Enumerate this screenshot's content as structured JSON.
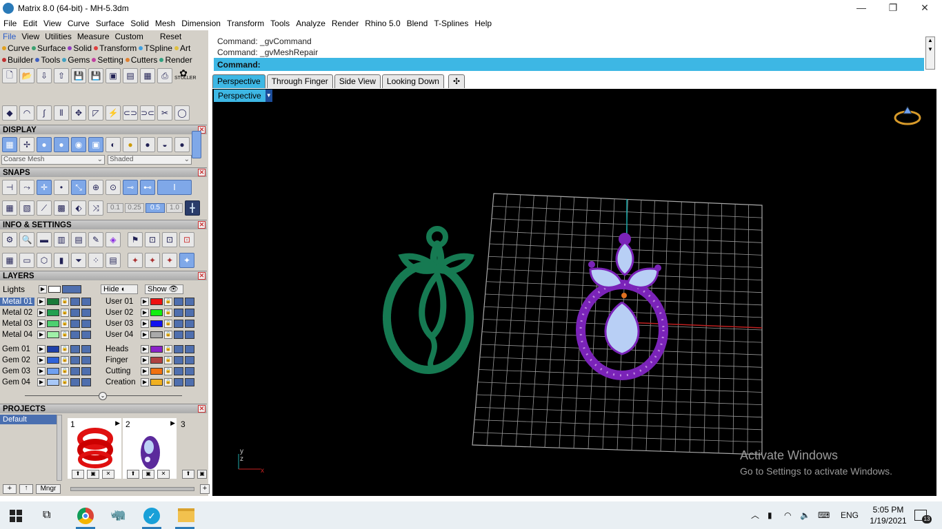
{
  "window": {
    "title": "Matrix 8.0 (64-bit) - MH-5.3dm",
    "minimize": "—",
    "restore": "❐",
    "close": "✕"
  },
  "menu": [
    "File",
    "Edit",
    "View",
    "Curve",
    "Surface",
    "Solid",
    "Mesh",
    "Dimension",
    "Transform",
    "Tools",
    "Analyze",
    "Render",
    "Rhino 5.0",
    "Blend",
    "T-Splines",
    "Help"
  ],
  "leftmenu": {
    "row1": [
      "File",
      "View",
      "Utilities",
      "Measure",
      "Custom",
      "Reset"
    ],
    "row2": [
      "Curve",
      "Surface",
      "Solid",
      "Transform",
      "TSpline",
      "Art"
    ],
    "row3": [
      "Builder",
      "Tools",
      "Gems",
      "Setting",
      "Cutters",
      "Render"
    ],
    "row2_colors": [
      "#e0a020",
      "#3aa070",
      "#9040c0",
      "#e04040",
      "#40a0e0",
      "#e0c040"
    ],
    "row3_colors": [
      "#c03030",
      "#4060c0",
      "#40a0c0",
      "#c040a0",
      "#e08030",
      "#30a080"
    ]
  },
  "stuller": "STULLER",
  "display": {
    "header": "DISPLAY",
    "mesh_mode": "Coarse Mesh",
    "shade_mode": "Shaded"
  },
  "snaps": {
    "header": "SNAPS",
    "values": [
      "0.1",
      "0.25",
      "0.5",
      "1.0"
    ]
  },
  "info": {
    "header": "INFO & SETTINGS"
  },
  "layers": {
    "header": "LAYERS",
    "lights": "Lights",
    "hide": "Hide",
    "show": "Show",
    "left": [
      {
        "name": "Metal 01",
        "color": "#1a7a3a",
        "selected": true
      },
      {
        "name": "Metal 02",
        "color": "#22a050"
      },
      {
        "name": "Metal 03",
        "color": "#4dd070"
      },
      {
        "name": "Metal 04",
        "color": "#a0f0a8"
      },
      {
        "name": "Gem 01",
        "color": "#1e3fa8"
      },
      {
        "name": "Gem 02",
        "color": "#2f63d8"
      },
      {
        "name": "Gem 03",
        "color": "#6fa0f0"
      },
      {
        "name": "Gem 04",
        "color": "#a8c8f8"
      }
    ],
    "right": [
      {
        "name": "User 01",
        "color": "#ee1111"
      },
      {
        "name": "User 02",
        "color": "#11ee11"
      },
      {
        "name": "User 03",
        "color": "#1111ee"
      },
      {
        "name": "User 04",
        "color": "#aaaaaa"
      },
      {
        "name": "Heads",
        "color": "#8a22c8"
      },
      {
        "name": "Finger",
        "color": "#b04040"
      },
      {
        "name": "Cutting",
        "color": "#f07010"
      },
      {
        "name": "Creation",
        "color": "#f0b020"
      }
    ]
  },
  "projects": {
    "header": "PROJECTS",
    "selected": "Default",
    "items": [
      "1",
      "2",
      "3"
    ],
    "mngr": "Mngr"
  },
  "commands": {
    "line1": "Command: _gvCommand",
    "line2": "Command: _gvMeshRepair",
    "prompt": "Command:"
  },
  "tabs": [
    "Perspective",
    "Through Finger",
    "Side View",
    "Looking Down"
  ],
  "tab_add": "✣",
  "viewport_label": "Perspective",
  "axis": {
    "y": "y",
    "z": "z",
    "x": "x"
  },
  "watermark": {
    "line1": "Activate Windows",
    "line2": "Go to Settings to activate Windows."
  },
  "tray": {
    "lang": "ENG",
    "time": "5:05 PM",
    "date": "1/19/2021",
    "notif": "13"
  }
}
